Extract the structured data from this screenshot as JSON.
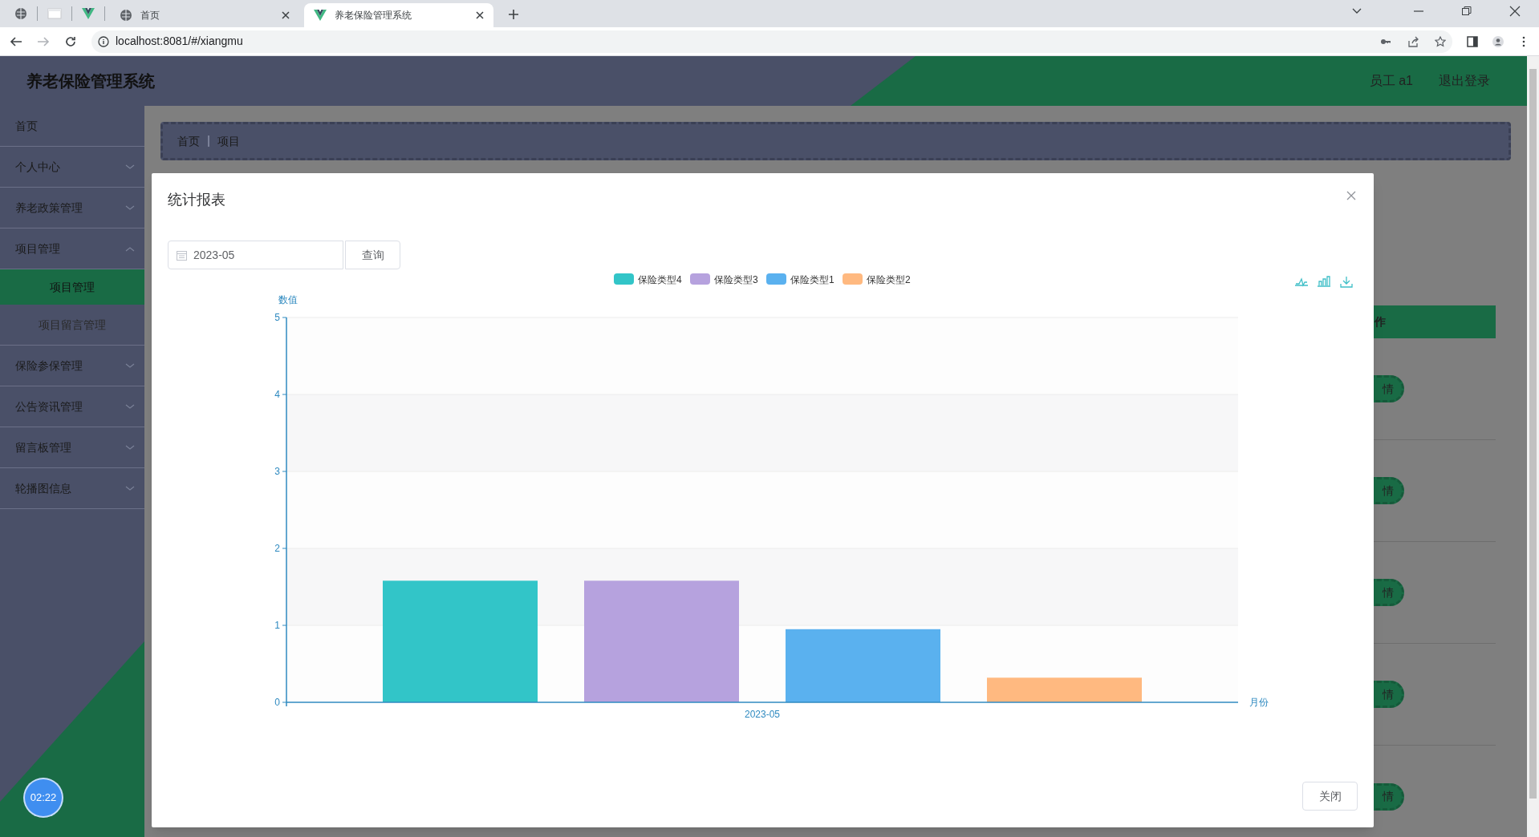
{
  "browser": {
    "tabs": [
      {
        "title": "首页",
        "selected": false
      },
      {
        "title": "养老保险管理系统",
        "selected": true
      }
    ],
    "url": "localhost:8081/#/xiangmu"
  },
  "header": {
    "title": "养老保险管理系统",
    "user": "员工 a1",
    "logout": "退出登录"
  },
  "sidebar": {
    "items": [
      {
        "label": "首页"
      },
      {
        "label": "个人中心"
      },
      {
        "label": "养老政策管理"
      },
      {
        "label": "项目管理",
        "expanded": true,
        "children": [
          {
            "label": "项目管理",
            "selected": true
          },
          {
            "label": "项目留言管理",
            "selected": false
          }
        ]
      },
      {
        "label": "保险参保管理"
      },
      {
        "label": "公告资讯管理"
      },
      {
        "label": "留言板管理"
      },
      {
        "label": "轮播图信息"
      }
    ]
  },
  "breadcrumb": [
    "首页",
    "项目"
  ],
  "table_behind": {
    "column_header": "作",
    "row_buttons": [
      "情",
      "情",
      "情",
      "情",
      "情"
    ]
  },
  "dialog": {
    "title": "统计报表",
    "date_field": {
      "value": "2023-05"
    },
    "query_button": "查询",
    "close_button": "关闭",
    "chart_data": {
      "type": "bar",
      "grid": true,
      "legend": true,
      "xlabel": "月份",
      "ylabel": "数值",
      "categories": [
        "2023-05"
      ],
      "ylim": [
        0,
        5
      ],
      "yticks": [
        0,
        1,
        2,
        3,
        4,
        5
      ],
      "series": [
        {
          "name": "保险类型4",
          "color": "#32c5c8",
          "values": [
            1.58
          ]
        },
        {
          "name": "保险类型3",
          "color": "#b6a2de",
          "values": [
            1.58
          ]
        },
        {
          "name": "保险类型1",
          "color": "#5ab1ef",
          "values": [
            0.95
          ]
        },
        {
          "name": "保险类型2",
          "color": "#ffb980",
          "values": [
            0.32
          ]
        }
      ]
    }
  },
  "timer": "02:22"
}
